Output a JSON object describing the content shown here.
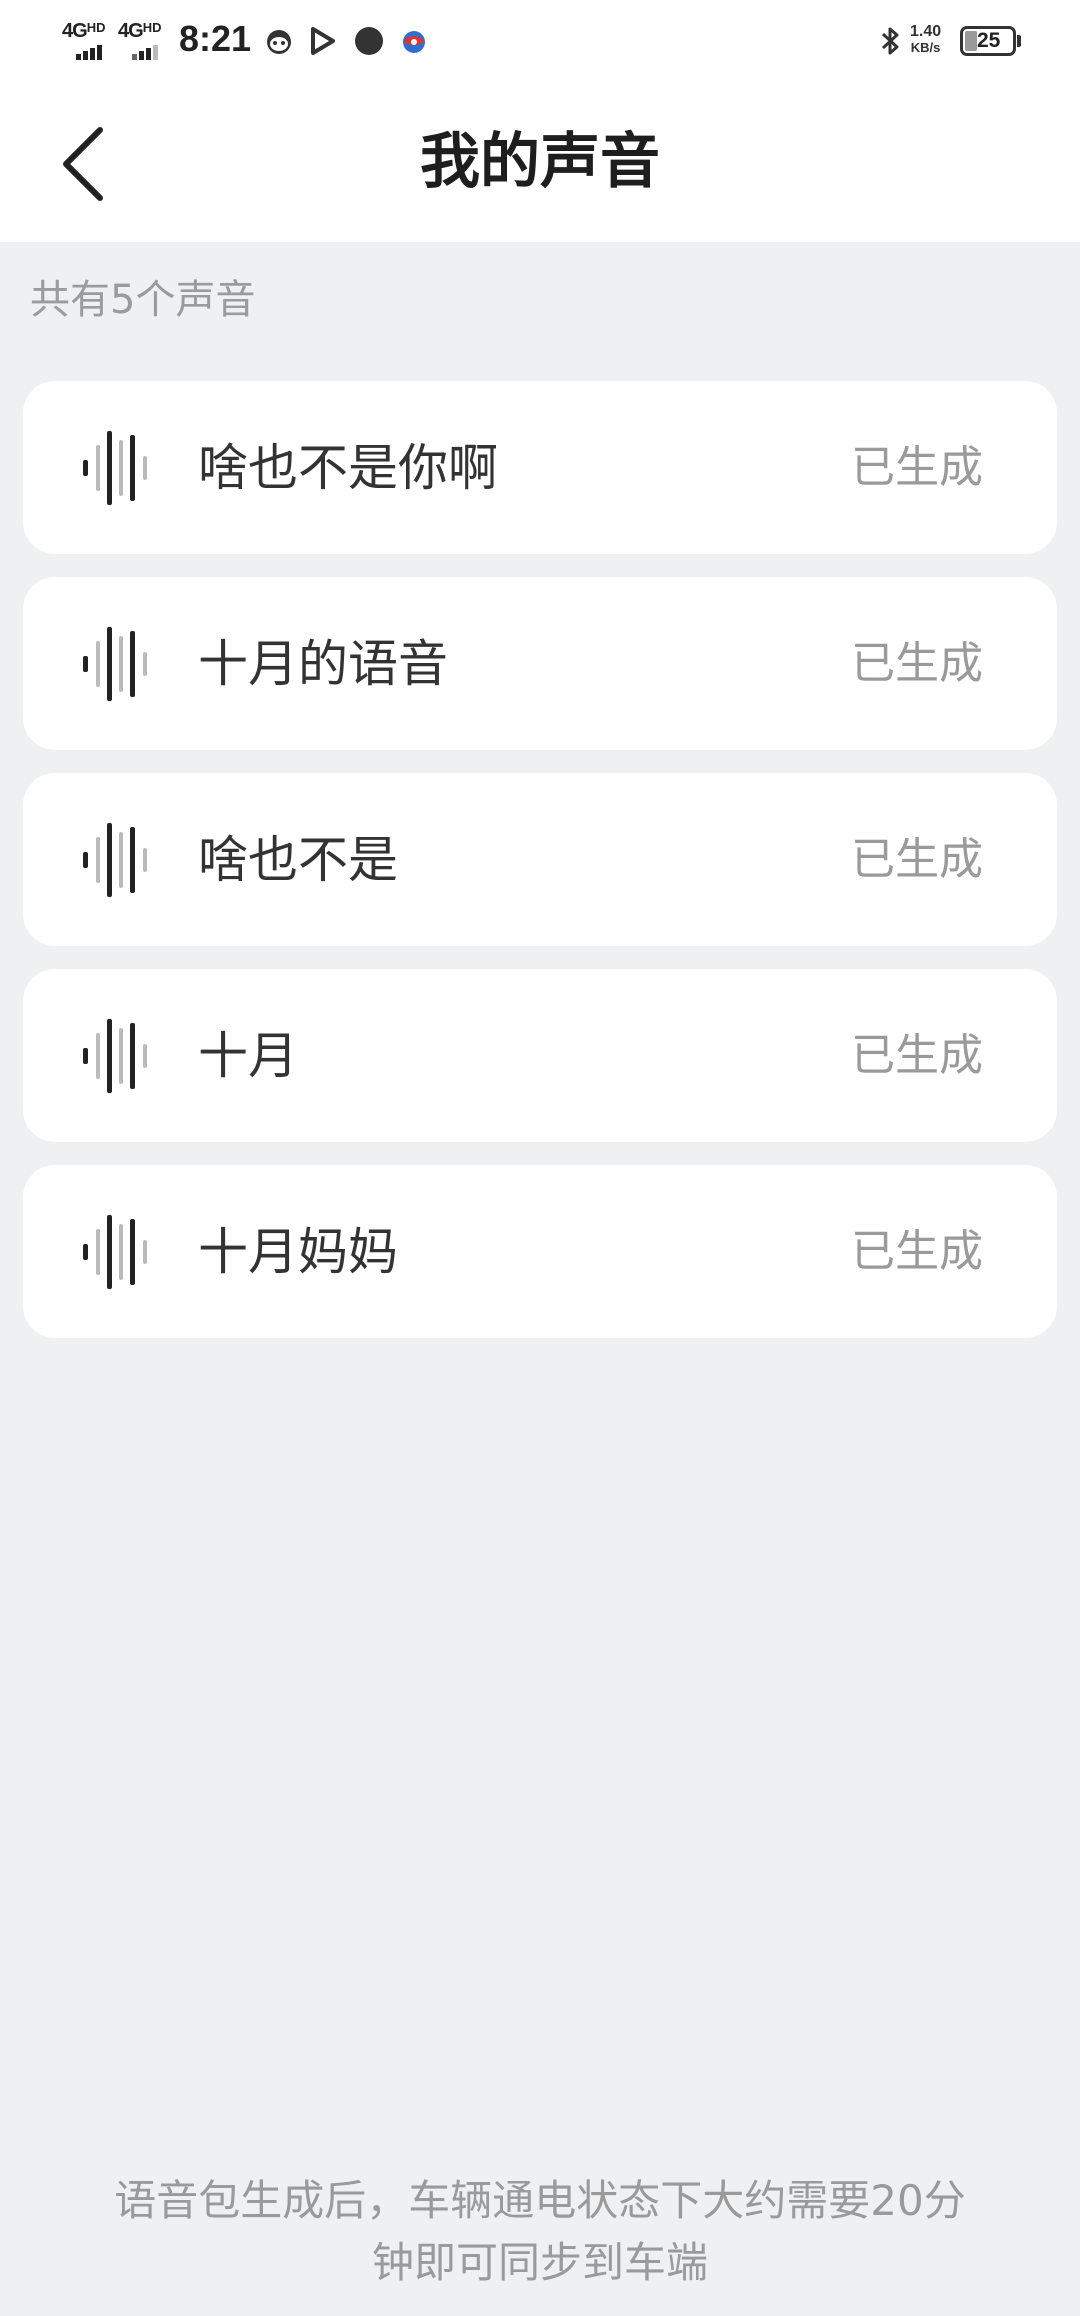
{
  "status_bar": {
    "network_1": "4G",
    "network_1_suffix": "HD",
    "network_2": "4G",
    "network_2_suffix": "HD",
    "time": "8:21",
    "speed_value": "1.40",
    "speed_unit": "KB/s",
    "battery": "25",
    "battery_level_percent": 25
  },
  "header": {
    "title": "我的声音"
  },
  "summary": {
    "count_label": "共有5个声音"
  },
  "voices": [
    {
      "name": "啥也不是你啊",
      "status": "已生成"
    },
    {
      "name": "十月的语音",
      "status": "已生成"
    },
    {
      "name": "啥也不是",
      "status": "已生成"
    },
    {
      "name": "十月",
      "status": "已生成"
    },
    {
      "name": "十月妈妈",
      "status": "已生成"
    }
  ],
  "footer": {
    "note_line_1": "语音包生成后，车辆通电状态下大约需要20分",
    "note_line_2": "钟即可同步到车端"
  },
  "colors": {
    "background": "#eff0f2",
    "card": "#ffffff",
    "title": "#1e1e1e",
    "muted": "#9a9a9a"
  }
}
